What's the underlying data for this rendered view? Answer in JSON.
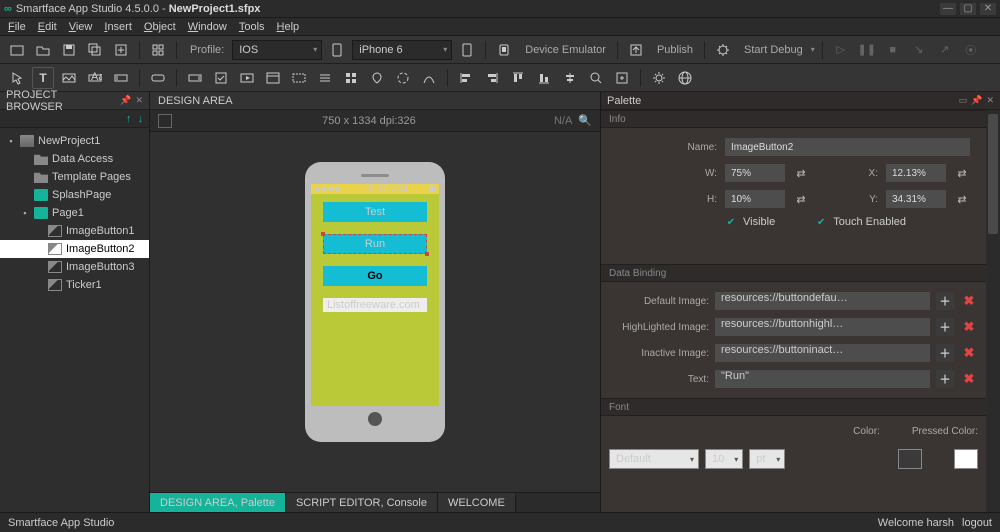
{
  "app": {
    "title_prefix": "Smartface App Studio 4.5.0.0 - ",
    "document": "NewProject1.sfpx",
    "status_text": "Smartface App Studio",
    "status_welcome": "Welcome harsh",
    "status_logout": "logout"
  },
  "menu": [
    "File",
    "Edit",
    "View",
    "Insert",
    "Object",
    "Window",
    "Tools",
    "Help"
  ],
  "toolbar1": {
    "profile_label": "Profile:",
    "profile_value": "IOS",
    "device_value": "iPhone 6",
    "device_emulator": "Device Emulator",
    "publish": "Publish",
    "start_debug": "Start Debug"
  },
  "project_browser": {
    "title": "PROJECT BROWSER",
    "root": "NewProject1",
    "nodes": [
      {
        "label": "Data Access",
        "icon": "folder"
      },
      {
        "label": "Template Pages",
        "icon": "folder"
      },
      {
        "label": "SplashPage",
        "icon": "page"
      }
    ],
    "page": {
      "label": "Page1",
      "children": [
        {
          "label": "ImageButton1",
          "icon": "img"
        },
        {
          "label": "ImageButton2",
          "icon": "img",
          "selected": true
        },
        {
          "label": "ImageButton3",
          "icon": "img"
        },
        {
          "label": "Ticker1",
          "icon": "img"
        }
      ]
    }
  },
  "design_area": {
    "title": "DESIGN AREA",
    "dimensions": "750 x 1334 dpi:326",
    "na": "N/A",
    "status_time": "11:45 AM",
    "buttons": [
      "Test",
      "Run",
      "Go"
    ],
    "label": "Listoffreeware.com"
  },
  "bottom_tabs": [
    "DESIGN AREA, Palette",
    "SCRIPT EDITOR, Console",
    "WELCOME"
  ],
  "palette": {
    "title": "Palette",
    "sections": {
      "info": "Info",
      "data_binding": "Data Binding",
      "font": "Font"
    },
    "info": {
      "name_label": "Name:",
      "name_value": "ImageButton2",
      "w_label": "W:",
      "w_value": "75%",
      "h_label": "H:",
      "h_value": "10%",
      "x_label": "X:",
      "x_value": "12.13%",
      "y_label": "Y:",
      "y_value": "34.31%",
      "visible": "Visible",
      "touch_enabled": "Touch Enabled"
    },
    "data_binding": {
      "default_label": "Default Image:",
      "default_value": "resources://buttondefau…",
      "high_label": "HighLighted Image:",
      "high_value": "resources://buttonhighl…",
      "inactive_label": "Inactive Image:",
      "inactive_value": "resources://buttoninact…",
      "text_label": "Text:",
      "text_value": "\"Run\""
    },
    "font": {
      "family": "Default",
      "size": "10",
      "unit": "pt",
      "color_label": "Color:",
      "pressed_color_label": "Pressed Color:"
    }
  }
}
